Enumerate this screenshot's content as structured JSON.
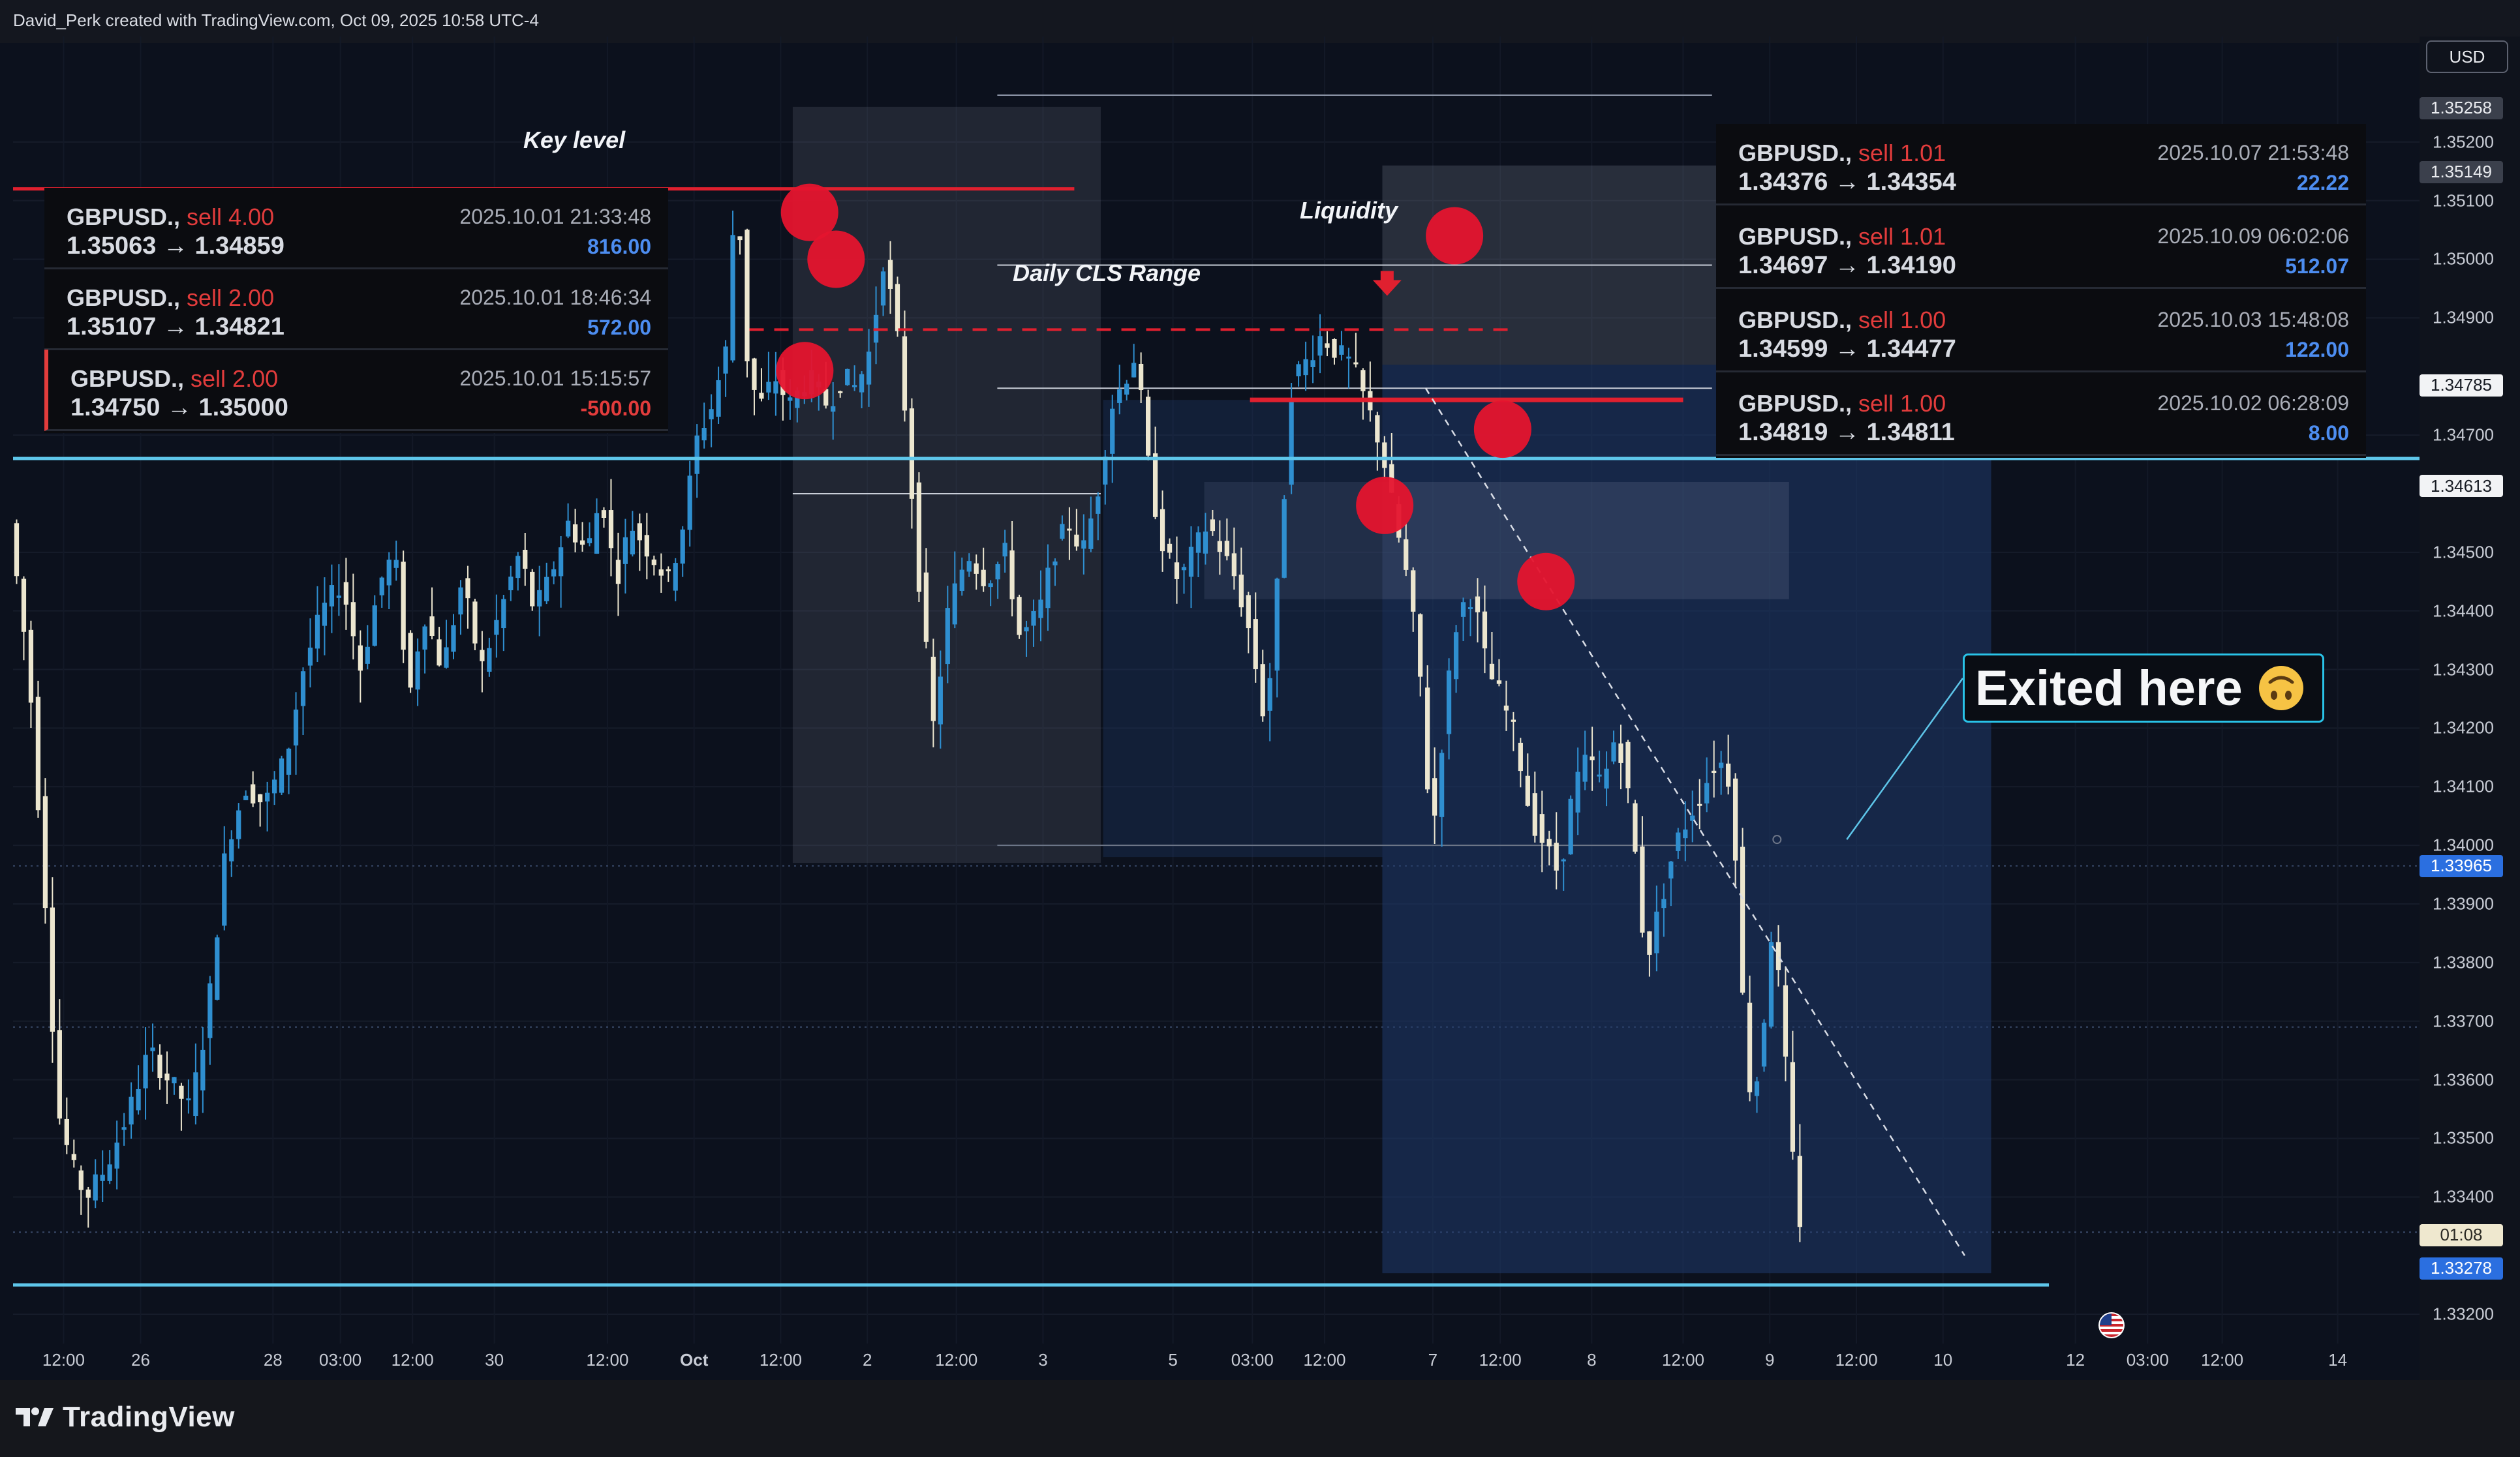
{
  "header": {
    "text": "David_Perk created with TradingView.com, Oct 09, 2025 10:58 UTC-4"
  },
  "brand": {
    "name": "TradingView",
    "icon": "tradingview-logo-icon"
  },
  "axis": {
    "currency": "USD"
  },
  "colors": {
    "background": "#0c111d",
    "up_candle": "#2f8fd0",
    "down_candle": "#ece6cf",
    "level_line": "#5ec6ea",
    "key_level": "#e0202f",
    "marker": "#e5142e",
    "zone_box": "#1f3a6b",
    "range_box": "#8d96aa"
  },
  "annotations": {
    "key_level": "Key level",
    "liquidity": "Liquidity",
    "daily_cls_range": "Daily CLS Range",
    "exited_here": "Exited here",
    "exited_emoji": "upside-down-face-icon"
  },
  "trades_left": [
    {
      "symbol": "GBPUSD.,",
      "side": "sell 4.00",
      "prices": "1.35063 → 1.34859",
      "time": "2025.10.01 21:33:48",
      "pnl": "816.00",
      "positive": true
    },
    {
      "symbol": "GBPUSD.,",
      "side": "sell 2.00",
      "prices": "1.35107 → 1.34821",
      "time": "2025.10.01 18:46:34",
      "pnl": "572.00",
      "positive": true
    },
    {
      "symbol": "GBPUSD.,",
      "side": "sell 2.00",
      "prices": "1.34750 → 1.35000",
      "time": "2025.10.01 15:15:57",
      "pnl": "-500.00",
      "positive": false
    }
  ],
  "trades_right": [
    {
      "symbol": "GBPUSD.,",
      "side": "sell 1.01",
      "prices": "1.34376 → 1.34354",
      "time": "2025.10.07 21:53:48",
      "pnl": "22.22",
      "positive": true
    },
    {
      "symbol": "GBPUSD.,",
      "side": "sell 1.01",
      "prices": "1.34697 → 1.34190",
      "time": "2025.10.09 06:02:06",
      "pnl": "512.07",
      "positive": true
    },
    {
      "symbol": "GBPUSD.,",
      "side": "sell 1.00",
      "prices": "1.34599 → 1.34477",
      "time": "2025.10.03 15:48:08",
      "pnl": "122.00",
      "positive": true
    },
    {
      "symbol": "GBPUSD.,",
      "side": "sell 1.00",
      "prices": "1.34819 → 1.34811",
      "time": "2025.10.02 06:28:09",
      "pnl": "8.00",
      "positive": true
    }
  ],
  "chart_data": {
    "type": "candlestick",
    "symbol": "GBPUSD",
    "ylim": [
      1.3315,
      1.3538
    ],
    "y_ticks": [
      "1.35200",
      "1.35100",
      "1.35000",
      "1.34900",
      "1.34700",
      "1.34500",
      "1.34400",
      "1.34300",
      "1.34200",
      "1.34100",
      "1.34000",
      "1.33900",
      "1.33800",
      "1.33700",
      "1.33600",
      "1.33500",
      "1.33400",
      "1.33200"
    ],
    "price_tags": [
      {
        "label": "1.35258",
        "value": 1.35258,
        "style": "muted"
      },
      {
        "label": "1.35149",
        "value": 1.35149,
        "style": "muted"
      },
      {
        "label": "1.34785",
        "value": 1.34785,
        "style": "white"
      },
      {
        "label": "1.34613",
        "value": 1.34613,
        "style": "white"
      },
      {
        "label": "1.33965",
        "value": 1.33965,
        "style": "blue"
      },
      {
        "label": "01:08",
        "value": 1.33335,
        "style": "cream"
      },
      {
        "label": "1.33278",
        "value": 1.33278,
        "style": "blue"
      }
    ],
    "x_tick_labels": [
      "12:00",
      "26",
      "28",
      "03:00",
      "12:00",
      "30",
      "12:00",
      "Oct",
      "12:00",
      "2",
      "12:00",
      "3",
      "5",
      "03:00",
      "12:00",
      "7",
      "12:00",
      "8",
      "12:00",
      "9",
      "12:00",
      "10",
      "12",
      "03:00",
      "12:00",
      "14"
    ],
    "x_tick_positions": [
      0.021,
      0.053,
      0.108,
      0.136,
      0.166,
      0.2,
      0.247,
      0.283,
      0.319,
      0.355,
      0.392,
      0.428,
      0.482,
      0.515,
      0.545,
      0.59,
      0.618,
      0.656,
      0.694,
      0.73,
      0.766,
      0.802,
      0.857,
      0.887,
      0.918,
      0.966
    ],
    "levels": {
      "key_level": 1.3512,
      "upper_cyan": 1.3466,
      "lower_cyan": 1.3325,
      "liquidity_dashed": 1.3488,
      "entry_red": 1.3476
    },
    "path": [
      [
        0.0,
        1.3455
      ],
      [
        0.008,
        1.343
      ],
      [
        0.015,
        1.339
      ],
      [
        0.02,
        1.3355
      ],
      [
        0.026,
        1.3345
      ],
      [
        0.032,
        1.334
      ],
      [
        0.04,
        1.3345
      ],
      [
        0.05,
        1.3355
      ],
      [
        0.058,
        1.3365
      ],
      [
        0.066,
        1.336
      ],
      [
        0.075,
        1.3355
      ],
      [
        0.082,
        1.337
      ],
      [
        0.09,
        1.34
      ],
      [
        0.098,
        1.341
      ],
      [
        0.106,
        1.3407
      ],
      [
        0.115,
        1.3415
      ],
      [
        0.122,
        1.343
      ],
      [
        0.13,
        1.344
      ],
      [
        0.138,
        1.3445
      ],
      [
        0.146,
        1.343
      ],
      [
        0.154,
        1.3445
      ],
      [
        0.16,
        1.345
      ],
      [
        0.166,
        1.3425
      ],
      [
        0.172,
        1.344
      ],
      [
        0.18,
        1.343
      ],
      [
        0.188,
        1.3445
      ],
      [
        0.196,
        1.343
      ],
      [
        0.204,
        1.344
      ],
      [
        0.212,
        1.345
      ],
      [
        0.218,
        1.344
      ],
      [
        0.224,
        1.3445
      ],
      [
        0.232,
        1.3455
      ],
      [
        0.24,
        1.345
      ],
      [
        0.246,
        1.346
      ],
      [
        0.252,
        1.3445
      ],
      [
        0.258,
        1.3455
      ],
      [
        0.266,
        1.345
      ],
      [
        0.274,
        1.3445
      ],
      [
        0.28,
        1.3455
      ],
      [
        0.286,
        1.347
      ],
      [
        0.292,
        1.3475
      ],
      [
        0.298,
        1.3485
      ],
      [
        0.302,
        1.3515
      ],
      [
        0.307,
        1.348
      ],
      [
        0.312,
        1.3475
      ],
      [
        0.318,
        1.348
      ],
      [
        0.324,
        1.3475
      ],
      [
        0.332,
        1.348
      ],
      [
        0.34,
        1.3475
      ],
      [
        0.346,
        1.348
      ],
      [
        0.352,
        1.3478
      ],
      [
        0.358,
        1.3485
      ],
      [
        0.363,
        1.35
      ],
      [
        0.368,
        1.349
      ],
      [
        0.372,
        1.3475
      ],
      [
        0.378,
        1.3445
      ],
      [
        0.384,
        1.342
      ],
      [
        0.39,
        1.344
      ],
      [
        0.398,
        1.345
      ],
      [
        0.406,
        1.3445
      ],
      [
        0.414,
        1.345
      ],
      [
        0.42,
        1.3435
      ],
      [
        0.428,
        1.344
      ],
      [
        0.434,
        1.345
      ],
      [
        0.44,
        1.3455
      ],
      [
        0.446,
        1.345
      ],
      [
        0.452,
        1.346
      ],
      [
        0.458,
        1.3475
      ],
      [
        0.464,
        1.348
      ],
      [
        0.468,
        1.3484
      ],
      [
        0.474,
        1.3462
      ],
      [
        0.48,
        1.345
      ],
      [
        0.486,
        1.3445
      ],
      [
        0.492,
        1.345
      ],
      [
        0.498,
        1.3455
      ],
      [
        0.504,
        1.345
      ],
      [
        0.51,
        1.3445
      ],
      [
        0.516,
        1.3435
      ],
      [
        0.522,
        1.342
      ],
      [
        0.528,
        1.345
      ],
      [
        0.533,
        1.348
      ],
      [
        0.538,
        1.3482
      ],
      [
        0.545,
        1.3487
      ],
      [
        0.552,
        1.3484
      ],
      [
        0.558,
        1.3482
      ],
      [
        0.564,
        1.3475
      ],
      [
        0.57,
        1.3468
      ],
      [
        0.576,
        1.3455
      ],
      [
        0.581,
        1.3445
      ],
      [
        0.586,
        1.343
      ],
      [
        0.591,
        1.34
      ],
      [
        0.597,
        1.3425
      ],
      [
        0.602,
        1.344
      ],
      [
        0.608,
        1.3443
      ],
      [
        0.614,
        1.343
      ],
      [
        0.62,
        1.3425
      ],
      [
        0.626,
        1.3418
      ],
      [
        0.632,
        1.3405
      ],
      [
        0.638,
        1.34
      ],
      [
        0.644,
        1.3395
      ],
      [
        0.65,
        1.341
      ],
      [
        0.656,
        1.3415
      ],
      [
        0.662,
        1.341
      ],
      [
        0.668,
        1.342
      ],
      [
        0.674,
        1.3405
      ],
      [
        0.68,
        1.338
      ],
      [
        0.686,
        1.339
      ],
      [
        0.692,
        1.34
      ],
      [
        0.698,
        1.3405
      ],
      [
        0.704,
        1.341
      ],
      [
        0.71,
        1.3415
      ],
      [
        0.716,
        1.341
      ],
      [
        0.72,
        1.3375
      ],
      [
        0.724,
        1.3355
      ],
      [
        0.728,
        1.3365
      ],
      [
        0.732,
        1.3385
      ],
      [
        0.736,
        1.3375
      ],
      [
        0.74,
        1.335
      ],
      [
        0.744,
        1.3336
      ]
    ]
  }
}
